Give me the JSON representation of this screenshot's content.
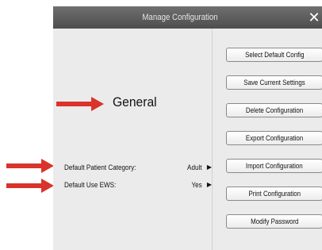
{
  "dialog": {
    "title": "Manage Configuration",
    "close_glyph": "✕"
  },
  "general": {
    "title": "General",
    "rows": [
      {
        "label": "Default Patient Category:",
        "value": "Adult",
        "icon": "chevron-right-icon"
      },
      {
        "label": "Default Use EWS:",
        "value": "Yes",
        "icon": "chevron-right-icon"
      }
    ]
  },
  "buttons": [
    {
      "label": "Select Default Config"
    },
    {
      "label": "Save Current Settings"
    },
    {
      "label": "Delete Configuration"
    },
    {
      "label": "Export Configuration"
    },
    {
      "label": "Import Configuration"
    },
    {
      "label": "Print Configuration"
    },
    {
      "label": "Modify Password"
    }
  ],
  "colors": {
    "titlebar": "#5a5a5a",
    "panel": "#ebebeb",
    "annotation_arrow": "#d9332b"
  }
}
